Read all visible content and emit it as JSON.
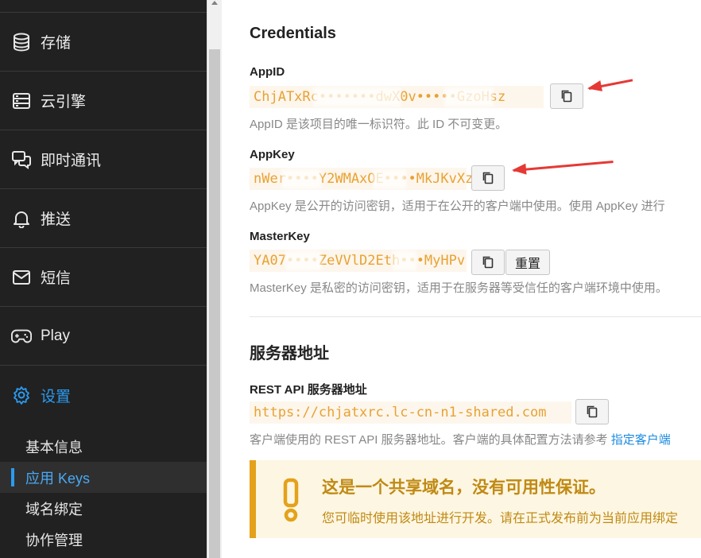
{
  "sidebar": {
    "nav": [
      {
        "label": "存储",
        "icon": "database-icon"
      },
      {
        "label": "云引擎",
        "icon": "server-icon"
      },
      {
        "label": "即时通讯",
        "icon": "chat-icon"
      },
      {
        "label": "推送",
        "icon": "bell-icon"
      },
      {
        "label": "短信",
        "icon": "envelope-icon"
      },
      {
        "label": "Play",
        "icon": "gamepad-icon"
      },
      {
        "label": "设置",
        "icon": "gear-icon"
      }
    ],
    "sub_items": [
      "基本信息",
      "应用 Keys",
      "域名绑定",
      "协作管理"
    ]
  },
  "credentials": {
    "title": "Credentials",
    "app_id": {
      "label": "AppID",
      "value": "ChjATxRc•••••••dwX0v•••••GzoHsz",
      "help": "AppID 是该项目的唯一标识符。此 ID 不可变更。"
    },
    "app_key": {
      "label": "AppKey",
      "value": "nWer••••Y2WMAxOE••••MkJKvXzs",
      "help": "AppKey 是公开的访问密钥，适用于在公开的客户端中使用。使用 AppKey 进行"
    },
    "master_key": {
      "label": "MasterKey",
      "value": "YA07••••ZeVVlD2Eth•••MyHPv",
      "help": "MasterKey 是私密的访问密钥，适用于在服务器等受信任的客户端环境中使用。",
      "reset_label": "重置"
    }
  },
  "server": {
    "title": "服务器地址",
    "rest_label": "REST API 服务器地址",
    "rest_url": "https://chjatxrc.lc-cn-n1-shared.com",
    "help_prefix": "客户端使用的 REST API 服务器地址。客户端的具体配置方法请参考",
    "help_link": "指定客户端"
  },
  "notice": {
    "title": "这是一个共享域名，没有可用性保证。",
    "text": "您可临时使用该地址进行开发。请在正式发布前为当前应用绑定"
  },
  "colors": {
    "sidebar_bg": "#212121",
    "accent": "#2b9bf0",
    "code_text": "#e8a233",
    "notice_border": "#e4a11b",
    "annotation_arrow": "#e53935"
  }
}
